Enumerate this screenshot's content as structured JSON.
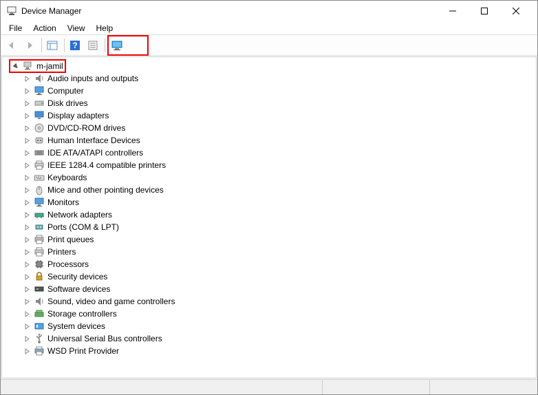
{
  "window": {
    "title": "Device Manager"
  },
  "menubar": {
    "file": "File",
    "action": "Action",
    "view": "View",
    "help": "Help"
  },
  "tree": {
    "root": {
      "label": "m-jamil",
      "expanded": true
    },
    "categories": [
      {
        "label": "Audio inputs and outputs",
        "icon": "audio"
      },
      {
        "label": "Computer",
        "icon": "computer"
      },
      {
        "label": "Disk drives",
        "icon": "disk"
      },
      {
        "label": "Display adapters",
        "icon": "display"
      },
      {
        "label": "DVD/CD-ROM drives",
        "icon": "dvd"
      },
      {
        "label": "Human Interface Devices",
        "icon": "hid"
      },
      {
        "label": "IDE ATA/ATAPI controllers",
        "icon": "ide"
      },
      {
        "label": "IEEE 1284.4 compatible printers",
        "icon": "printer"
      },
      {
        "label": "Keyboards",
        "icon": "keyboard"
      },
      {
        "label": "Mice and other pointing devices",
        "icon": "mouse"
      },
      {
        "label": "Monitors",
        "icon": "monitor"
      },
      {
        "label": "Network adapters",
        "icon": "network"
      },
      {
        "label": "Ports (COM & LPT)",
        "icon": "port"
      },
      {
        "label": "Print queues",
        "icon": "printqueue"
      },
      {
        "label": "Printers",
        "icon": "printer2"
      },
      {
        "label": "Processors",
        "icon": "cpu"
      },
      {
        "label": "Security devices",
        "icon": "security"
      },
      {
        "label": "Software devices",
        "icon": "software"
      },
      {
        "label": "Sound, video and game controllers",
        "icon": "sound"
      },
      {
        "label": "Storage controllers",
        "icon": "storage"
      },
      {
        "label": "System devices",
        "icon": "system"
      },
      {
        "label": "Universal Serial Bus controllers",
        "icon": "usb"
      },
      {
        "label": "WSD Print Provider",
        "icon": "wsd"
      }
    ]
  }
}
